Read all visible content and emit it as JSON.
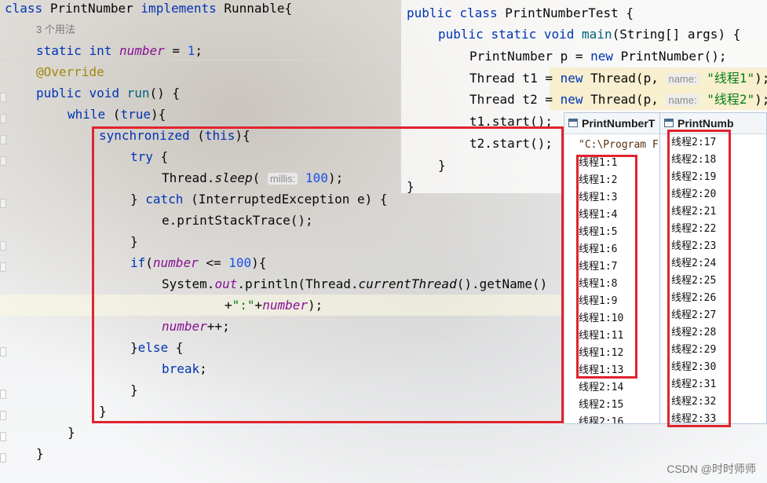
{
  "left_editor": {
    "line1": {
      "kw_class": "class",
      "name": "PrintNumber",
      "kw_impl": "implements",
      "iface": "Runnable{"
    },
    "usages": "3 个用法",
    "line2": {
      "kw_static": "static",
      "kw_int": "int",
      "field": "number",
      "eq": " = ",
      "val": "1",
      ";": ";"
    },
    "override": "@Override",
    "run": {
      "kw_public": "public",
      "kw_void": "void",
      "name": "run",
      "rest": "() {"
    },
    "while": {
      "kw": "while",
      "rest": " (",
      "kw_true": "true",
      "end": "){"
    },
    "sync": {
      "kw": "synchronized",
      "rest": " (",
      "kw_this": "this",
      "end": "){"
    },
    "try": {
      "kw": "try",
      "rest": " {"
    },
    "sleep": {
      "cls": "Thread.",
      "method": "sleep",
      "open": "(",
      "hint": "millis:",
      "val": "100",
      "end": ");"
    },
    "catch": {
      "pre": "} ",
      "kw": "catch",
      "rest": " (InterruptedException e) {"
    },
    "print_trace": "e.printStackTrace();",
    "close1": "}",
    "if": {
      "kw": "if",
      "open": "(",
      "field": "number",
      "op": " <= ",
      "val": "100",
      "end": "){"
    },
    "println": {
      "pre": "System.",
      "out": "out",
      "mid": ".println(Thread.",
      "ct": "currentThread",
      "end": "().getName()"
    },
    "concat": {
      "plus": "+",
      "str": "\":\"",
      "plus2": "+",
      "field": "number",
      "end": ");"
    },
    "incr": {
      "field": "number",
      "op": "++;"
    },
    "else": {
      "pre": "}",
      "kw": "else",
      "rest": " {"
    },
    "break": {
      "kw": "break",
      "end": ";"
    },
    "close2": "}",
    "close3": "}",
    "close4": "}",
    "close5": "}"
  },
  "right_editor": {
    "l1": {
      "kw_public": "public",
      "kw_class": "class",
      "name": "PrintNumberTest {"
    },
    "l2": {
      "kw_public": "public",
      "kw_static": "static",
      "kw_void": "void",
      "name": "main",
      "rest": "(String[] args) {"
    },
    "l3": {
      "pre": "PrintNumber p = ",
      "kw_new": "new",
      "post": " PrintNumber();"
    },
    "l4": {
      "pre": "Thread t1 = ",
      "kw_new": "new",
      "post": " Thread(p, ",
      "hint": "name:",
      "str": "\"线程1\"",
      "end": ");"
    },
    "l5": {
      "pre": "Thread t2 = ",
      "kw_new": "new",
      "post": " Thread(p, ",
      "hint": "name:",
      "str": "\"线程2\"",
      "end": ");"
    },
    "l6": "t1.start();",
    "l7": "t2.start();",
    "l8": "}",
    "l9": "}"
  },
  "console1": {
    "title": "PrintNumberT",
    "cmd": "\"C:\\Program F",
    "lines": [
      "线程1:1",
      "线程1:2",
      "线程1:3",
      "线程1:4",
      "线程1:5",
      "线程1:6",
      "线程1:7",
      "线程1:8",
      "线程1:9",
      "线程1:10",
      "线程1:11",
      "线程1:12",
      "线程1:13",
      "线程2:14",
      "线程2:15",
      "线程2:16"
    ]
  },
  "console2": {
    "title": "PrintNumb",
    "lines": [
      "线程2:17",
      "线程2:18",
      "线程2:19",
      "线程2:20",
      "线程2:21",
      "线程2:22",
      "线程2:23",
      "线程2:24",
      "线程2:25",
      "线程2:26",
      "线程2:27",
      "线程2:28",
      "线程2:29",
      "线程2:30",
      "线程2:31",
      "线程2:32",
      "线程2:33"
    ]
  },
  "watermark": "CSDN @时时师师",
  "colors": {
    "keyword": "#0033b3",
    "field": "#871094",
    "number": "#1750eb",
    "string": "#067d17",
    "annotation": "#9e880d",
    "highlight_box": "#e0242f"
  }
}
